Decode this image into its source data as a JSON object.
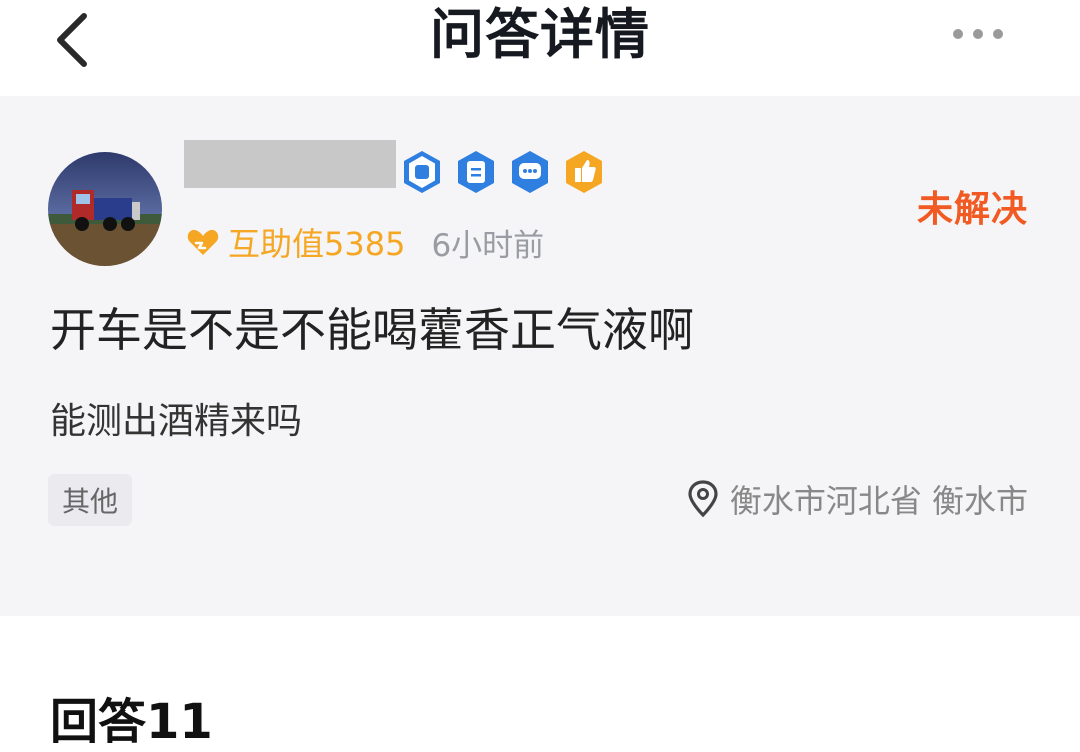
{
  "header": {
    "title": "问答详情"
  },
  "question": {
    "status": "未解决",
    "help_value": "互助值5385",
    "time": "6小时前",
    "title": "开车是不是不能喝藿香正气液啊",
    "body": "能测出酒精来吗",
    "tag": "其他",
    "location": "衡水市河北省 衡水市"
  },
  "answers": {
    "heading": "回答11"
  },
  "colors": {
    "status": "#f15a22",
    "help_value": "#f5a623",
    "card_background": "#f5f5f7"
  },
  "icons": [
    "back-icon",
    "more-icon",
    "fist-badge-icon",
    "document-badge-icon",
    "chat-badge-icon",
    "thumbs-up-badge-icon",
    "help-heart-icon",
    "location-pin-icon"
  ]
}
